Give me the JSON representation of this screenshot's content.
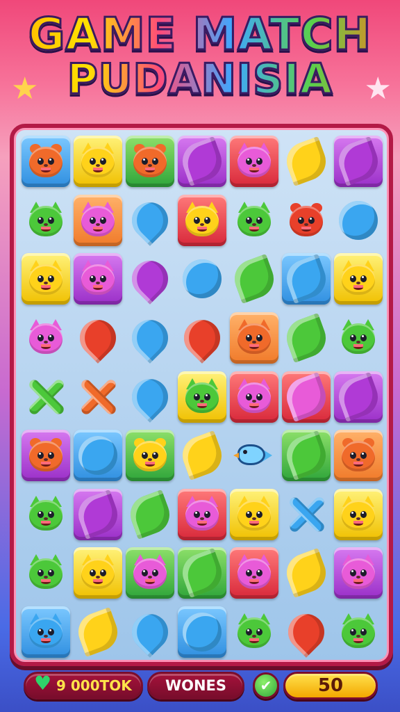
{
  "title": {
    "line1": "GAME MATCH",
    "line2": "PUDANISIA"
  },
  "decor": {
    "left_star_icon": "star-icon",
    "right_star_icon": "star-icon"
  },
  "colors": {
    "board_border": "#b31a46",
    "orange": "#f06a2a",
    "yellow": "#ffd21a",
    "green": "#4cc83a",
    "pink": "#e85bd8",
    "purple": "#b03ad6",
    "blue": "#3aa6f0",
    "red": "#e8402a"
  },
  "grid": {
    "rows": 9,
    "cols": 7,
    "cells": [
      [
        {
          "kind": "beaver",
          "tile": "blue",
          "fg": "orange"
        },
        {
          "kind": "cat",
          "tile": "yellow",
          "fg": "yellow"
        },
        {
          "kind": "bear",
          "tile": "green",
          "fg": "orange"
        },
        {
          "kind": "leaf",
          "tile": "purple",
          "fg": "purple"
        },
        {
          "kind": "cat",
          "tile": "red",
          "fg": "pink"
        },
        {
          "kind": "leaf",
          "tile": "none",
          "fg": "yellow"
        },
        {
          "kind": "leaf",
          "tile": "purple",
          "fg": "purple"
        }
      ],
      [
        {
          "kind": "cat",
          "tile": "none",
          "fg": "green"
        },
        {
          "kind": "cat",
          "tile": "orange",
          "fg": "pink"
        },
        {
          "kind": "drop",
          "tile": "none",
          "fg": "blue"
        },
        {
          "kind": "cat",
          "tile": "red",
          "fg": "yellow"
        },
        {
          "kind": "cat",
          "tile": "none",
          "fg": "green"
        },
        {
          "kind": "beaver",
          "tile": "none",
          "fg": "red"
        },
        {
          "kind": "orb",
          "tile": "none",
          "fg": "blue"
        }
      ],
      [
        {
          "kind": "cat",
          "tile": "yellow",
          "fg": "yellow"
        },
        {
          "kind": "cat",
          "tile": "purple",
          "fg": "pink"
        },
        {
          "kind": "drop",
          "tile": "none",
          "fg": "purple"
        },
        {
          "kind": "orb",
          "tile": "none",
          "fg": "blue"
        },
        {
          "kind": "leaf",
          "tile": "none",
          "fg": "green"
        },
        {
          "kind": "leaf",
          "tile": "blue",
          "fg": "blue"
        },
        {
          "kind": "cat",
          "tile": "yellow",
          "fg": "yellow"
        }
      ],
      [
        {
          "kind": "cat",
          "tile": "none",
          "fg": "pink"
        },
        {
          "kind": "drop",
          "tile": "none",
          "fg": "red"
        },
        {
          "kind": "drop",
          "tile": "none",
          "fg": "blue"
        },
        {
          "kind": "drop",
          "tile": "none",
          "fg": "red"
        },
        {
          "kind": "cat",
          "tile": "orange",
          "fg": "orange"
        },
        {
          "kind": "leaf",
          "tile": "none",
          "fg": "green"
        },
        {
          "kind": "cat",
          "tile": "none",
          "fg": "green"
        }
      ],
      [
        {
          "kind": "x",
          "tile": "none",
          "fg": "green"
        },
        {
          "kind": "x",
          "tile": "none",
          "fg": "orange"
        },
        {
          "kind": "drop",
          "tile": "none",
          "fg": "blue"
        },
        {
          "kind": "cat",
          "tile": "yellow",
          "fg": "green"
        },
        {
          "kind": "cat",
          "tile": "red",
          "fg": "pink"
        },
        {
          "kind": "leaf",
          "tile": "red",
          "fg": "pink"
        },
        {
          "kind": "leaf",
          "tile": "purple",
          "fg": "purple"
        }
      ],
      [
        {
          "kind": "bear",
          "tile": "purple",
          "fg": "orange"
        },
        {
          "kind": "orb",
          "tile": "blue",
          "fg": "blue"
        },
        {
          "kind": "bear",
          "tile": "green",
          "fg": "yellow"
        },
        {
          "kind": "leaf",
          "tile": "none",
          "fg": "yellow"
        },
        {
          "kind": "fish",
          "tile": "none",
          "fg": "blue"
        },
        {
          "kind": "leaf",
          "tile": "green",
          "fg": "green"
        },
        {
          "kind": "bear",
          "tile": "orange",
          "fg": "orange"
        }
      ],
      [
        {
          "kind": "cat",
          "tile": "none",
          "fg": "green"
        },
        {
          "kind": "leaf",
          "tile": "purple",
          "fg": "purple"
        },
        {
          "kind": "leaf",
          "tile": "none",
          "fg": "green"
        },
        {
          "kind": "cat",
          "tile": "red",
          "fg": "pink"
        },
        {
          "kind": "cat",
          "tile": "yellow",
          "fg": "yellow"
        },
        {
          "kind": "x",
          "tile": "none",
          "fg": "blue"
        },
        {
          "kind": "cat",
          "tile": "yellow",
          "fg": "yellow"
        }
      ],
      [
        {
          "kind": "cat",
          "tile": "none",
          "fg": "green"
        },
        {
          "kind": "cat",
          "tile": "yellow",
          "fg": "yellow"
        },
        {
          "kind": "cat",
          "tile": "green",
          "fg": "pink"
        },
        {
          "kind": "leaf",
          "tile": "green",
          "fg": "green"
        },
        {
          "kind": "cat",
          "tile": "red",
          "fg": "pink"
        },
        {
          "kind": "leaf",
          "tile": "none",
          "fg": "yellow"
        },
        {
          "kind": "cat",
          "tile": "purple",
          "fg": "pink"
        }
      ],
      [
        {
          "kind": "cat",
          "tile": "blue",
          "fg": "blue"
        },
        {
          "kind": "leaf",
          "tile": "none",
          "fg": "yellow"
        },
        {
          "kind": "drop",
          "tile": "none",
          "fg": "blue"
        },
        {
          "kind": "orb",
          "tile": "blue",
          "fg": "blue"
        },
        {
          "kind": "cat",
          "tile": "none",
          "fg": "green"
        },
        {
          "kind": "drop",
          "tile": "none",
          "fg": "red"
        },
        {
          "kind": "cat",
          "tile": "none",
          "fg": "green"
        }
      ]
    ]
  },
  "bottom_bar": {
    "coins_icon": "heart-icon",
    "coins_label": "9 000TOK",
    "mode_label": "WONES",
    "check_icon": "check-icon",
    "check_glyph": "✔",
    "score_value": "50"
  }
}
